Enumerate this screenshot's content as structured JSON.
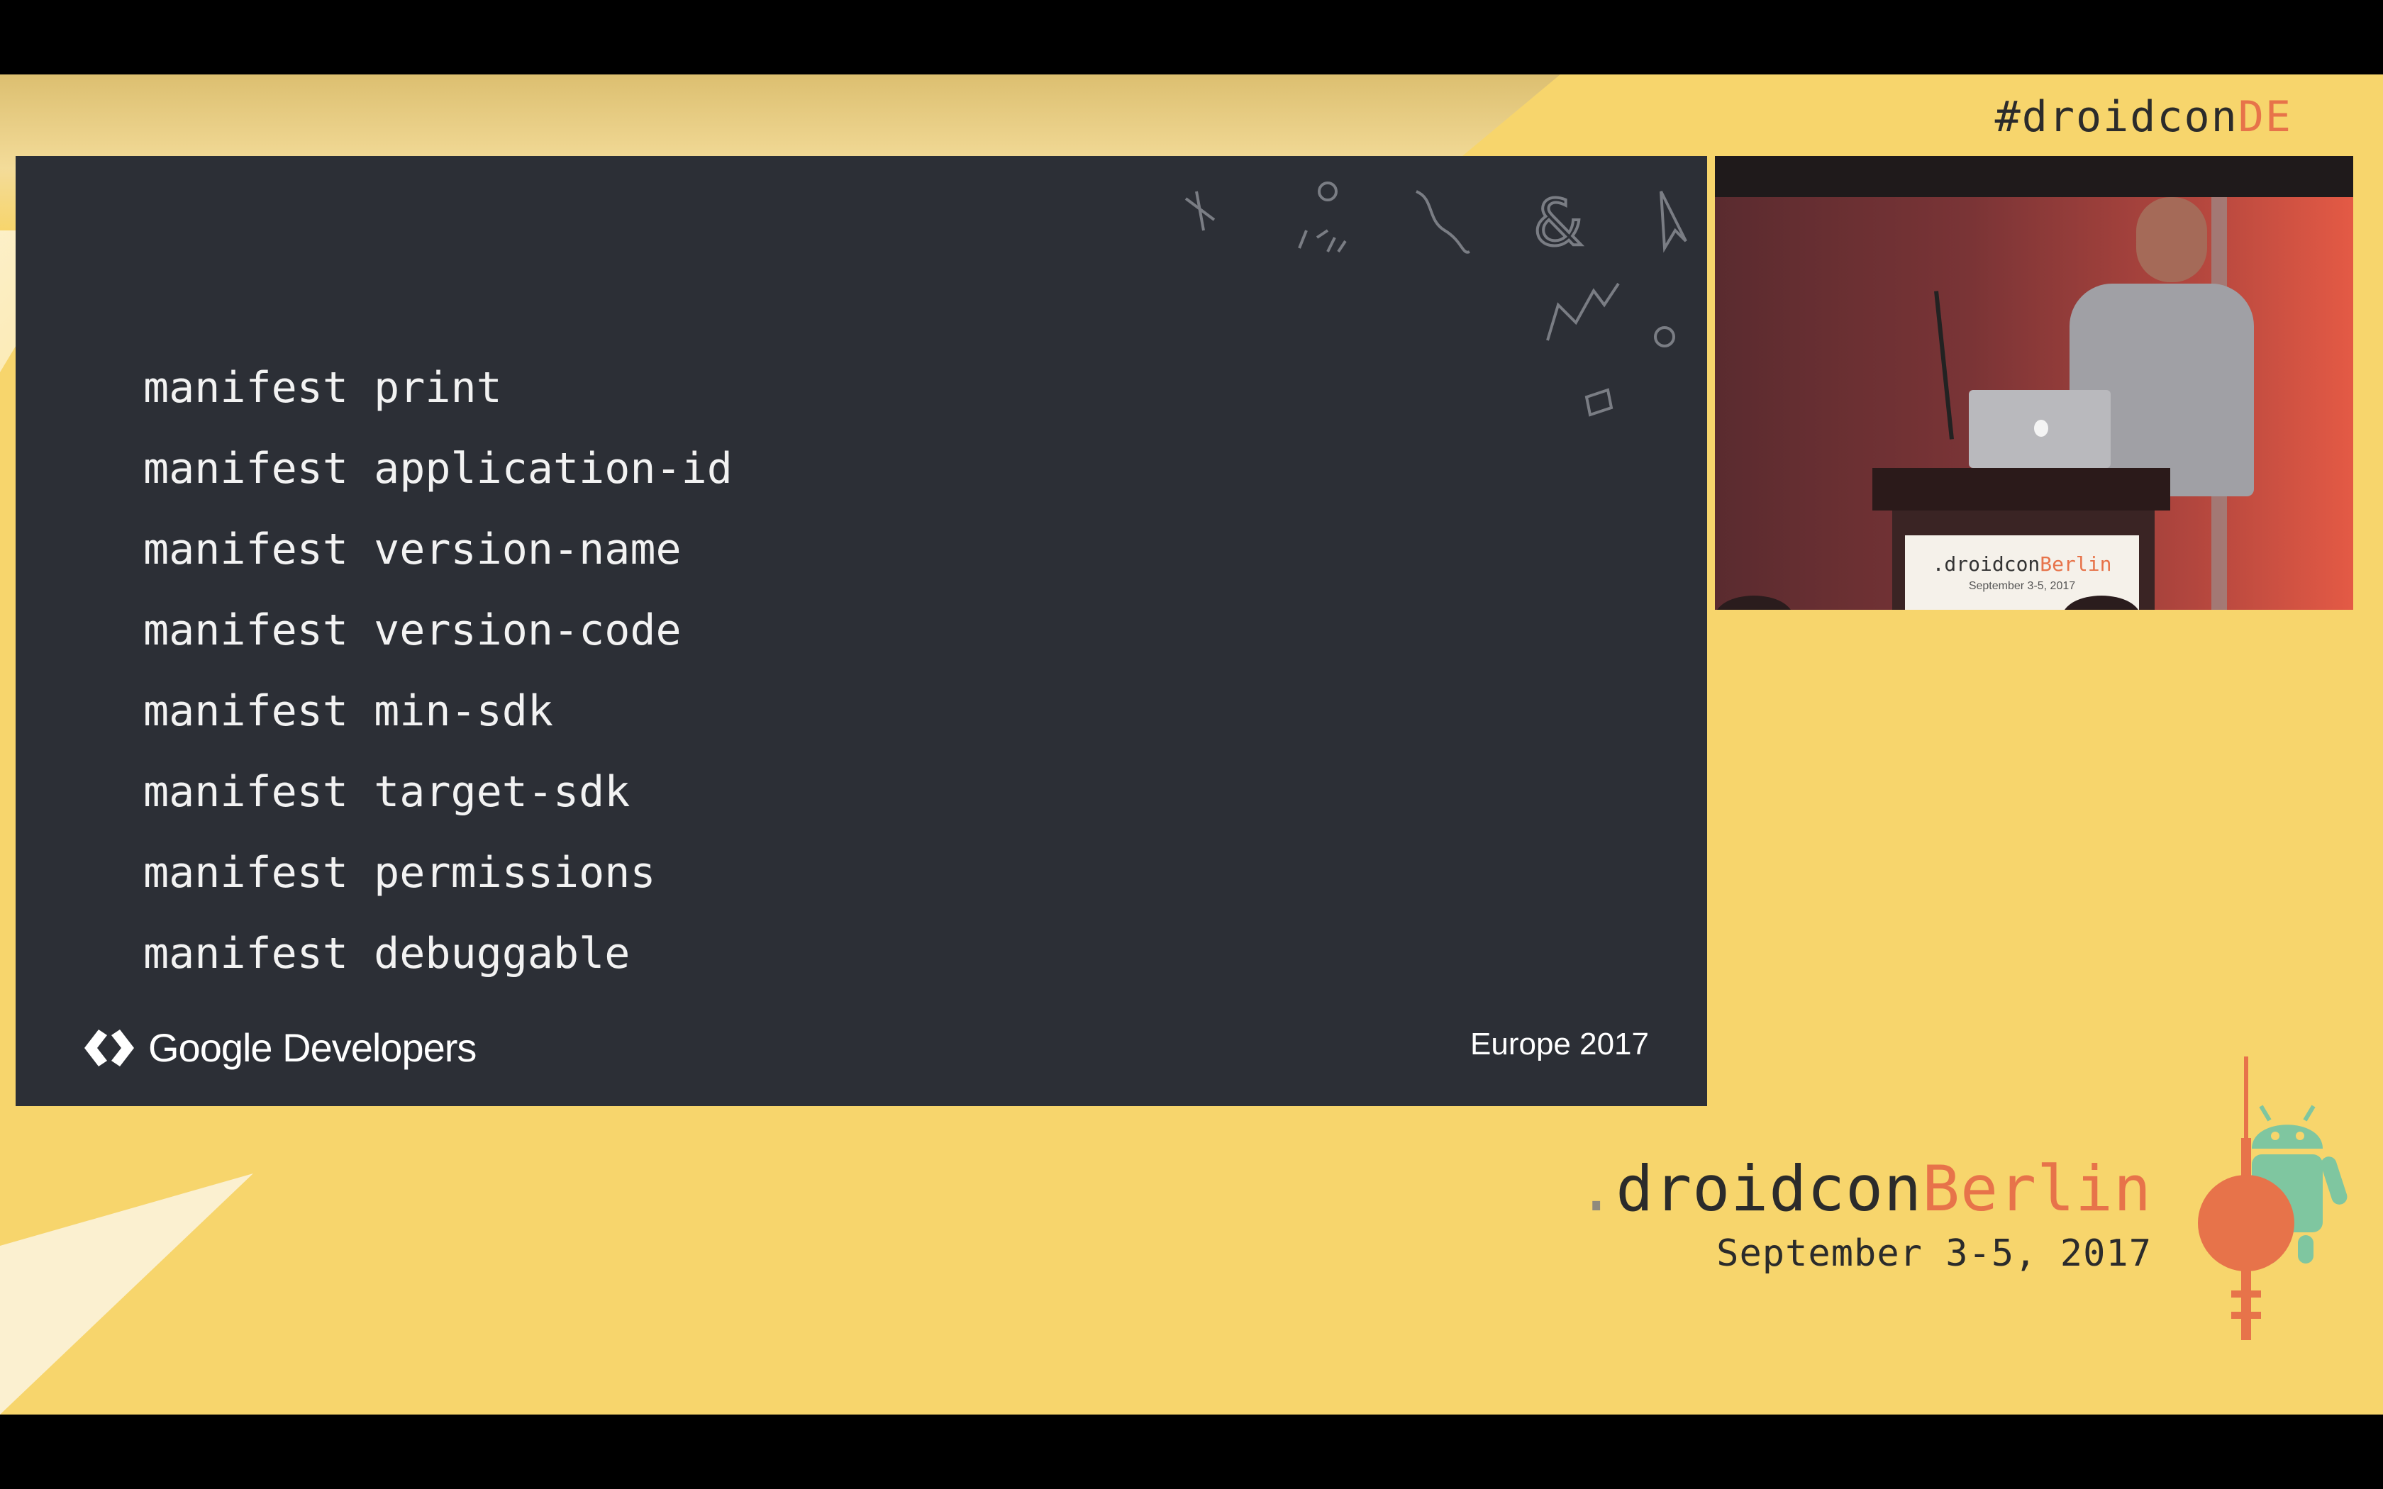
{
  "hashtag": {
    "prefix": "#droidcon",
    "accent": "DE"
  },
  "slide": {
    "commands": [
      "manifest print",
      "manifest application-id",
      "manifest version-name",
      "manifest version-code",
      "manifest min-sdk",
      "manifest target-sdk",
      "manifest permissions",
      "manifest debuggable"
    ],
    "logo_text": "Google Developers",
    "event_label": "Europe 2017"
  },
  "video": {
    "podium_sign": {
      "prefix": ".droidcon",
      "accent": "Berlin",
      "date": "September 3-5, 2017"
    }
  },
  "brand": {
    "dot": ".",
    "name": "droidcon",
    "accent": "Berlin",
    "date": "September 3-5, 2017"
  },
  "colors": {
    "background_yellow": "#f7d56c",
    "slide_dark": "#2c2f36",
    "accent_orange": "#e7734a",
    "android_green": "#7fc6a0"
  }
}
